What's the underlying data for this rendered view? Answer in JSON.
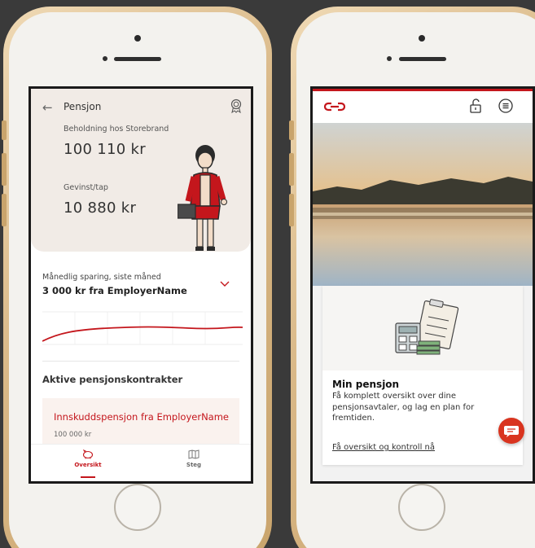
{
  "left_app": {
    "header": {
      "title": "Pensjon"
    },
    "hero": {
      "holding_label": "Beholdning hos Storebrand",
      "holding_value": "100 110 kr",
      "gain_label": "Gevinst/tap",
      "gain_value": "10 880 kr"
    },
    "monthly": {
      "label": "Månedlig sparing, siste måned",
      "value": "3 000 kr fra EmployerName"
    },
    "contracts": {
      "heading": "Aktive pensjonskontrakter",
      "items": [
        {
          "title": "Innskuddspensjon fra EmployerName",
          "amount": "100 000 kr"
        }
      ]
    },
    "tabs": [
      {
        "label": "Oversikt",
        "icon": "piggy-bank-icon",
        "active": true
      },
      {
        "label": "Steg",
        "icon": "map-icon",
        "active": false
      }
    ]
  },
  "right_app": {
    "header": {
      "logo": "storebrand-logo",
      "icons": [
        "lock-open-icon",
        "menu-icon"
      ]
    },
    "card": {
      "title": "Min pensjon",
      "description": "Få komplett oversikt over dine pensjonsavtaler, og lag en plan for fremtiden.",
      "link": "Få oversikt og kontroll nå"
    }
  },
  "colors": {
    "accent": "#c4161c",
    "hero_bg": "#f1ebe6",
    "phone_gold": "#d9b887"
  }
}
